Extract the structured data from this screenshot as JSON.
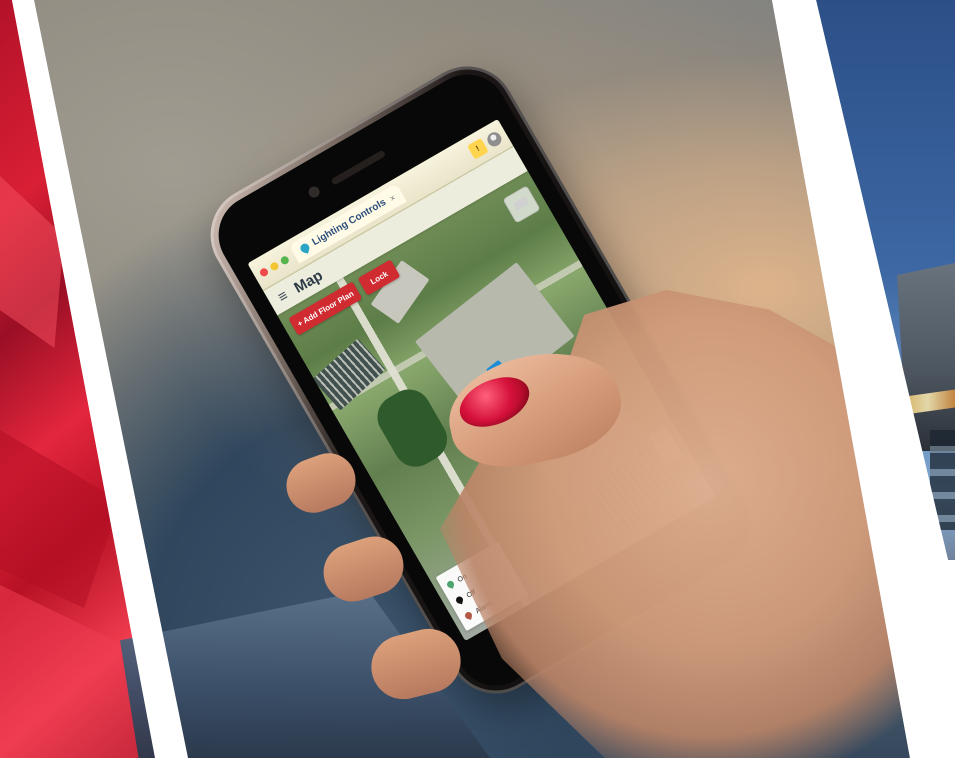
{
  "browser": {
    "tab_title": "Lighting Controls",
    "close_symbol": "×"
  },
  "app": {
    "menu_symbol": "≡",
    "page_title": "Map"
  },
  "map_controls": {
    "add_floor_plan": "+ Add Floor Plan",
    "lock": "Lock",
    "zoom_in": "+",
    "zoom_out": "−"
  },
  "legend": {
    "items": [
      {
        "label": "On",
        "color": "#4ca56f",
        "icon": "map-pin-icon"
      },
      {
        "label": "Off",
        "color": "#111111",
        "icon": "map-pin-icon"
      },
      {
        "label": "Alarm",
        "color": "#b25845",
        "icon": "map-pin-icon"
      }
    ]
  },
  "colors": {
    "red_panel": "#cf2b31",
    "browser_bar": "#f7f3dc",
    "nail": "#d5113a",
    "sky": "#3d68a4"
  }
}
